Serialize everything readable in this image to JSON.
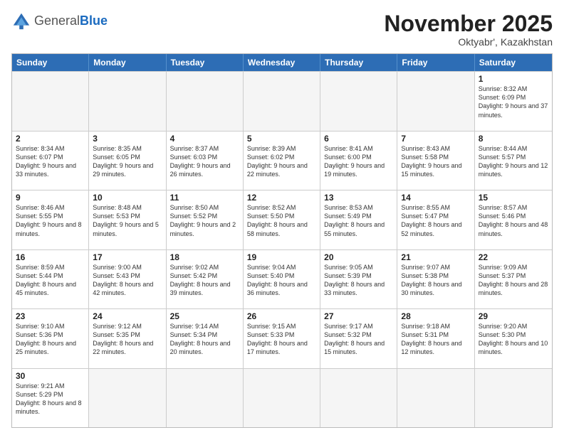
{
  "header": {
    "logo_general": "General",
    "logo_blue": "Blue",
    "month_title": "November 2025",
    "location": "Oktyabr', Kazakhstan"
  },
  "days_of_week": [
    "Sunday",
    "Monday",
    "Tuesday",
    "Wednesday",
    "Thursday",
    "Friday",
    "Saturday"
  ],
  "weeks": [
    [
      {
        "day": "",
        "info": "",
        "empty": true
      },
      {
        "day": "",
        "info": "",
        "empty": true
      },
      {
        "day": "",
        "info": "",
        "empty": true
      },
      {
        "day": "",
        "info": "",
        "empty": true
      },
      {
        "day": "",
        "info": "",
        "empty": true
      },
      {
        "day": "",
        "info": "",
        "empty": true
      },
      {
        "day": "1",
        "info": "Sunrise: 8:32 AM\nSunset: 6:09 PM\nDaylight: 9 hours and 37 minutes.",
        "empty": false
      }
    ],
    [
      {
        "day": "2",
        "info": "Sunrise: 8:34 AM\nSunset: 6:07 PM\nDaylight: 9 hours and 33 minutes.",
        "empty": false
      },
      {
        "day": "3",
        "info": "Sunrise: 8:35 AM\nSunset: 6:05 PM\nDaylight: 9 hours and 29 minutes.",
        "empty": false
      },
      {
        "day": "4",
        "info": "Sunrise: 8:37 AM\nSunset: 6:03 PM\nDaylight: 9 hours and 26 minutes.",
        "empty": false
      },
      {
        "day": "5",
        "info": "Sunrise: 8:39 AM\nSunset: 6:02 PM\nDaylight: 9 hours and 22 minutes.",
        "empty": false
      },
      {
        "day": "6",
        "info": "Sunrise: 8:41 AM\nSunset: 6:00 PM\nDaylight: 9 hours and 19 minutes.",
        "empty": false
      },
      {
        "day": "7",
        "info": "Sunrise: 8:43 AM\nSunset: 5:58 PM\nDaylight: 9 hours and 15 minutes.",
        "empty": false
      },
      {
        "day": "8",
        "info": "Sunrise: 8:44 AM\nSunset: 5:57 PM\nDaylight: 9 hours and 12 minutes.",
        "empty": false
      }
    ],
    [
      {
        "day": "9",
        "info": "Sunrise: 8:46 AM\nSunset: 5:55 PM\nDaylight: 9 hours and 8 minutes.",
        "empty": false
      },
      {
        "day": "10",
        "info": "Sunrise: 8:48 AM\nSunset: 5:53 PM\nDaylight: 9 hours and 5 minutes.",
        "empty": false
      },
      {
        "day": "11",
        "info": "Sunrise: 8:50 AM\nSunset: 5:52 PM\nDaylight: 9 hours and 2 minutes.",
        "empty": false
      },
      {
        "day": "12",
        "info": "Sunrise: 8:52 AM\nSunset: 5:50 PM\nDaylight: 8 hours and 58 minutes.",
        "empty": false
      },
      {
        "day": "13",
        "info": "Sunrise: 8:53 AM\nSunset: 5:49 PM\nDaylight: 8 hours and 55 minutes.",
        "empty": false
      },
      {
        "day": "14",
        "info": "Sunrise: 8:55 AM\nSunset: 5:47 PM\nDaylight: 8 hours and 52 minutes.",
        "empty": false
      },
      {
        "day": "15",
        "info": "Sunrise: 8:57 AM\nSunset: 5:46 PM\nDaylight: 8 hours and 48 minutes.",
        "empty": false
      }
    ],
    [
      {
        "day": "16",
        "info": "Sunrise: 8:59 AM\nSunset: 5:44 PM\nDaylight: 8 hours and 45 minutes.",
        "empty": false
      },
      {
        "day": "17",
        "info": "Sunrise: 9:00 AM\nSunset: 5:43 PM\nDaylight: 8 hours and 42 minutes.",
        "empty": false
      },
      {
        "day": "18",
        "info": "Sunrise: 9:02 AM\nSunset: 5:42 PM\nDaylight: 8 hours and 39 minutes.",
        "empty": false
      },
      {
        "day": "19",
        "info": "Sunrise: 9:04 AM\nSunset: 5:40 PM\nDaylight: 8 hours and 36 minutes.",
        "empty": false
      },
      {
        "day": "20",
        "info": "Sunrise: 9:05 AM\nSunset: 5:39 PM\nDaylight: 8 hours and 33 minutes.",
        "empty": false
      },
      {
        "day": "21",
        "info": "Sunrise: 9:07 AM\nSunset: 5:38 PM\nDaylight: 8 hours and 30 minutes.",
        "empty": false
      },
      {
        "day": "22",
        "info": "Sunrise: 9:09 AM\nSunset: 5:37 PM\nDaylight: 8 hours and 28 minutes.",
        "empty": false
      }
    ],
    [
      {
        "day": "23",
        "info": "Sunrise: 9:10 AM\nSunset: 5:36 PM\nDaylight: 8 hours and 25 minutes.",
        "empty": false
      },
      {
        "day": "24",
        "info": "Sunrise: 9:12 AM\nSunset: 5:35 PM\nDaylight: 8 hours and 22 minutes.",
        "empty": false
      },
      {
        "day": "25",
        "info": "Sunrise: 9:14 AM\nSunset: 5:34 PM\nDaylight: 8 hours and 20 minutes.",
        "empty": false
      },
      {
        "day": "26",
        "info": "Sunrise: 9:15 AM\nSunset: 5:33 PM\nDaylight: 8 hours and 17 minutes.",
        "empty": false
      },
      {
        "day": "27",
        "info": "Sunrise: 9:17 AM\nSunset: 5:32 PM\nDaylight: 8 hours and 15 minutes.",
        "empty": false
      },
      {
        "day": "28",
        "info": "Sunrise: 9:18 AM\nSunset: 5:31 PM\nDaylight: 8 hours and 12 minutes.",
        "empty": false
      },
      {
        "day": "29",
        "info": "Sunrise: 9:20 AM\nSunset: 5:30 PM\nDaylight: 8 hours and 10 minutes.",
        "empty": false
      }
    ],
    [
      {
        "day": "30",
        "info": "Sunrise: 9:21 AM\nSunset: 5:29 PM\nDaylight: 8 hours and 8 minutes.",
        "empty": false
      },
      {
        "day": "",
        "info": "",
        "empty": true
      },
      {
        "day": "",
        "info": "",
        "empty": true
      },
      {
        "day": "",
        "info": "",
        "empty": true
      },
      {
        "day": "",
        "info": "",
        "empty": true
      },
      {
        "day": "",
        "info": "",
        "empty": true
      },
      {
        "day": "",
        "info": "",
        "empty": true
      }
    ]
  ]
}
